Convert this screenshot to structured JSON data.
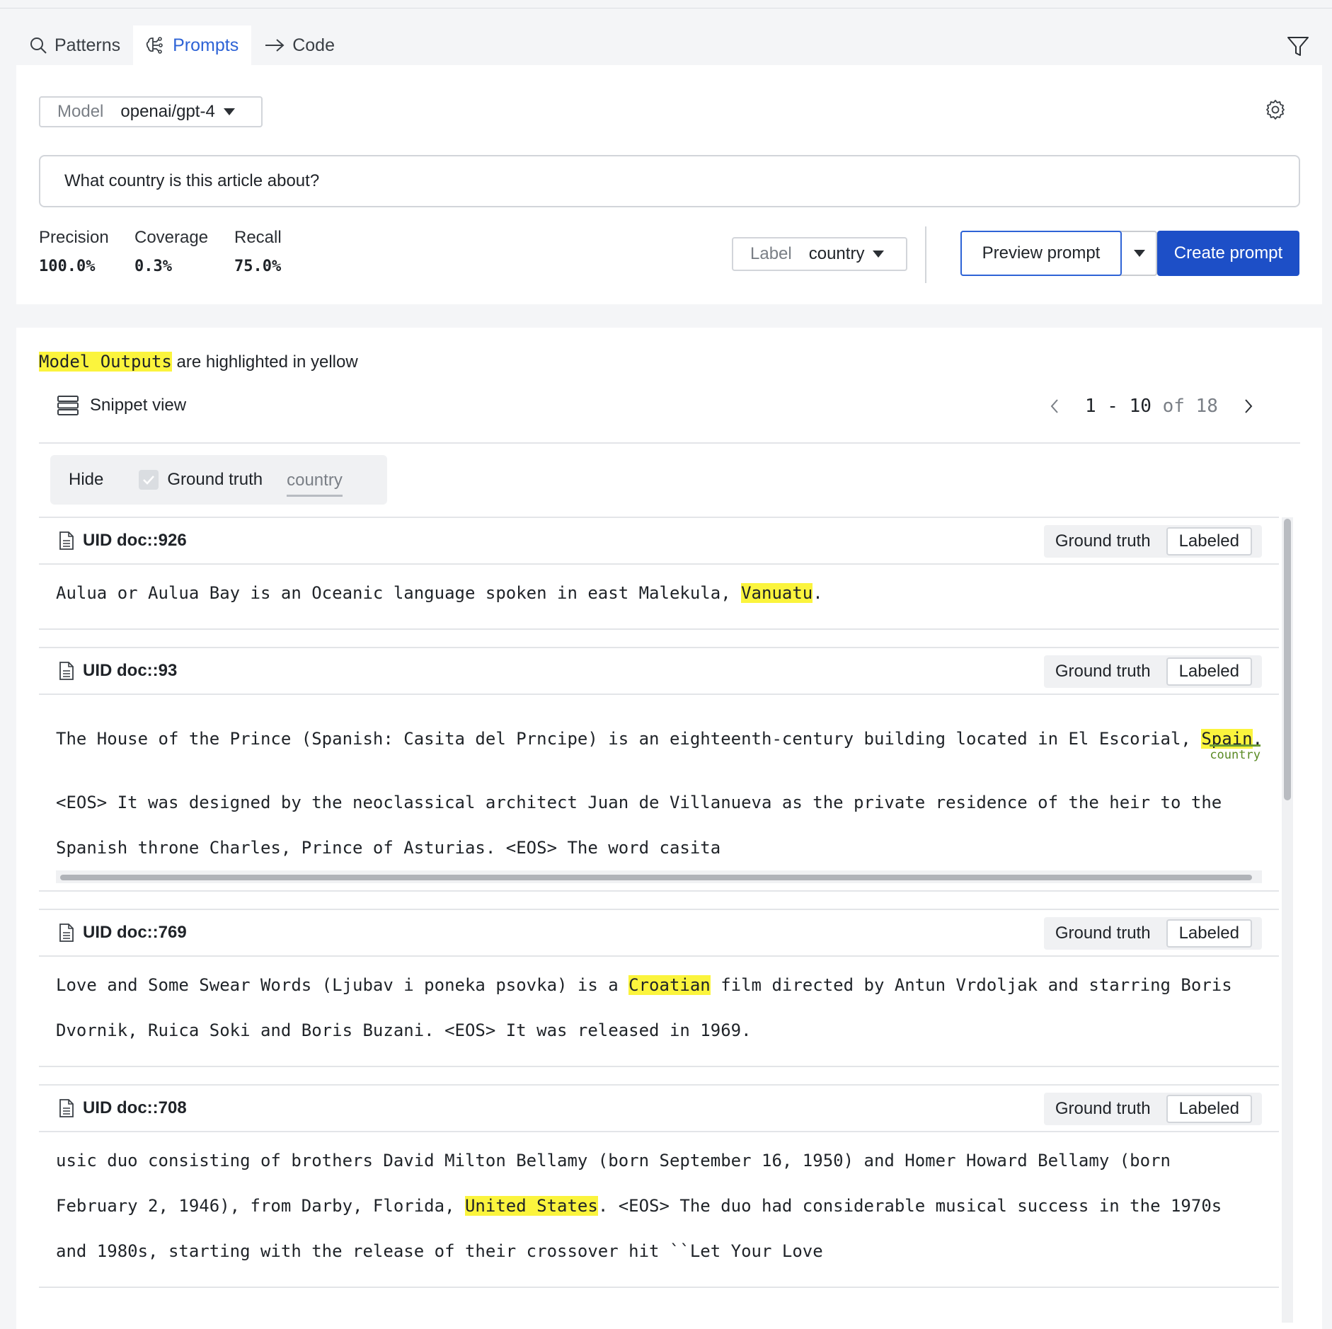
{
  "tabs": [
    {
      "label": "Patterns",
      "icon": "search-icon"
    },
    {
      "label": "Prompts",
      "icon": "brain-icon"
    },
    {
      "label": "Code",
      "icon": "arrow-right-icon"
    }
  ],
  "active_tab": "Prompts",
  "model": {
    "label": "Model",
    "value": "openai/gpt-4"
  },
  "prompt": {
    "value": "What country is this article about?"
  },
  "metrics": [
    {
      "label": "Precision",
      "value": "100.0%"
    },
    {
      "label": "Coverage",
      "value": "0.3%"
    },
    {
      "label": "Recall",
      "value": "75.0%"
    }
  ],
  "label_select": {
    "label": "Label",
    "value": "country"
  },
  "actions": {
    "preview": "Preview prompt",
    "create": "Create prompt"
  },
  "legend": {
    "highlight": "Model Outputs",
    "rest": " are highlighted in yellow"
  },
  "snippet_view": "Snippet view",
  "pager": {
    "range": "1 - 10",
    "of": "of 18"
  },
  "filterbar": {
    "hide": "Hide",
    "ground_truth": "Ground truth",
    "country": "country"
  },
  "doc_labels": {
    "ground_truth": "Ground truth",
    "status": "Labeled",
    "country_tag": "country"
  },
  "docs": [
    {
      "uid": "UID doc::926",
      "text": {
        "pre": "Aulua or Aulua Bay is an Oceanic language spoken in east Malekula, ",
        "hl": "Vanuatu",
        "post": "."
      }
    },
    {
      "uid": "UID doc::93",
      "text": {
        "pre": "The House of the Prince (Spanish: Casita del Prncipe) is an eighteenth-century building located in El Escorial, ",
        "hl": "Spain",
        "post": ".",
        "line2": "<EOS> It was designed by the neoclassical architect Juan de Villanueva as the private residence of the heir to the",
        "line3": "Spanish throne Charles, Prince of Asturias. <EOS> The word casita"
      }
    },
    {
      "uid": "UID doc::769",
      "text": {
        "pre": "Love and Some Swear Words (Ljubav i poneka psovka) is a ",
        "hl": "Croatian",
        "post": " film directed by Antun Vrdoljak and starring Boris Dvornik, Ruica Soki and Boris Buzani. <EOS> It was released in 1969."
      }
    },
    {
      "uid": "UID doc::708",
      "text": {
        "pre": "usic duo consisting of brothers David Milton Bellamy (born September 16, 1950) and Homer Howard Bellamy (born February 2, 1946), from Darby, Florida, ",
        "hl": "United States",
        "post": ". <EOS> The duo had considerable musical success in the 1970s and 1980s, starting with the release of their crossover hit ``Let Your Love"
      }
    }
  ]
}
